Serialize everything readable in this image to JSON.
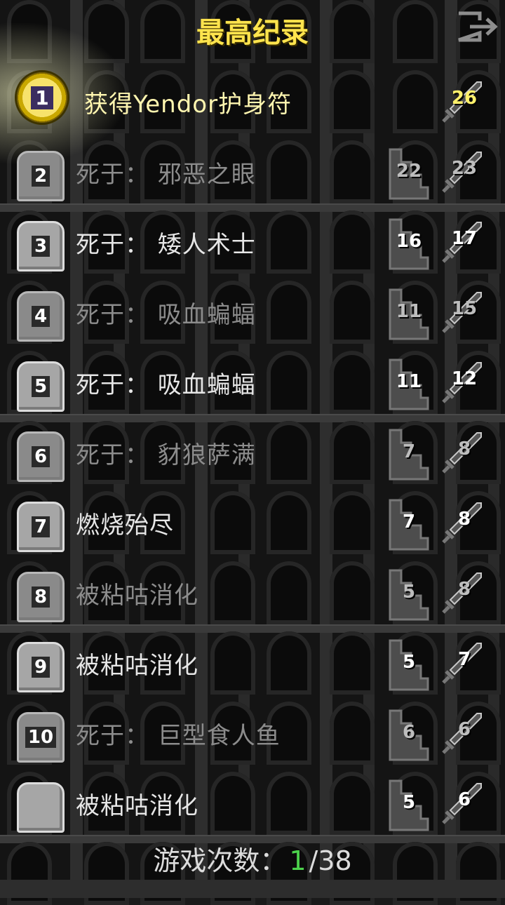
{
  "title": "最高纪录",
  "icons": {
    "exit": "exit-icon",
    "depth": "stairs-icon",
    "level": "sword-icon",
    "amulet": "amulet-icon",
    "tombstone": "tombstone-icon"
  },
  "colors": {
    "title": "#ffe44d",
    "current_games": "#4cd24c"
  },
  "records": [
    {
      "rank": "1",
      "cause": "获得Yendor护身符",
      "depth": "",
      "level": "26",
      "winner": true,
      "style": "gold"
    },
    {
      "rank": "2",
      "cause": "死于：  邪恶之眼",
      "depth": "22",
      "level": "23",
      "style": "gray"
    },
    {
      "rank": "3",
      "cause": "死于：  矮人术士",
      "depth": "16",
      "level": "17",
      "style": "white"
    },
    {
      "rank": "4",
      "cause": "死于：  吸血蝙蝠",
      "depth": "11",
      "level": "15",
      "style": "gray"
    },
    {
      "rank": "5",
      "cause": "死于：  吸血蝙蝠",
      "depth": "11",
      "level": "12",
      "style": "white"
    },
    {
      "rank": "6",
      "cause": "死于：  豺狼萨满",
      "depth": "7",
      "level": "8",
      "style": "gray"
    },
    {
      "rank": "7",
      "cause": "燃烧殆尽",
      "depth": "7",
      "level": "8",
      "style": "white"
    },
    {
      "rank": "8",
      "cause": "被粘咕消化",
      "depth": "5",
      "level": "8",
      "style": "gray"
    },
    {
      "rank": "9",
      "cause": "被粘咕消化",
      "depth": "5",
      "level": "7",
      "style": "white"
    },
    {
      "rank": "10",
      "cause": "死于：  巨型食人鱼",
      "depth": "6",
      "level": "6",
      "style": "gray"
    },
    {
      "rank": "",
      "cause": "被粘咕消化",
      "depth": "5",
      "level": "6",
      "style": "white"
    }
  ],
  "footer": {
    "label": "游戏次数：",
    "current": "1",
    "total": "/38"
  }
}
